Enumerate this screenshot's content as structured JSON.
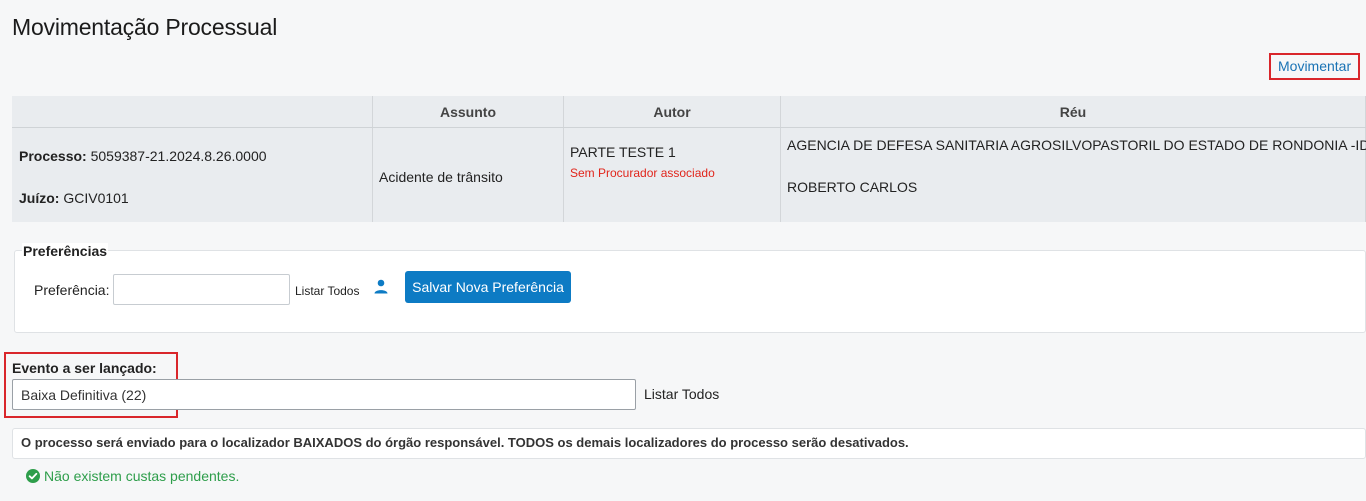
{
  "page": {
    "title": "Movimentação Processual"
  },
  "actions": {
    "movimentar_label": "Movimentar"
  },
  "table": {
    "headers": [
      "",
      "Assunto",
      "Autor",
      "Réu"
    ],
    "processo_label": "Processo:",
    "processo_value": "5059387-21.2024.8.26.0000",
    "juizo_label": "Juízo:",
    "juizo_value": "GCIV0101",
    "assunto": "Acidente de trânsito",
    "autor": "PARTE TESTE 1",
    "autor_note": "Sem Procurador associado",
    "reu": [
      "AGENCIA DE DEFESA SANITARIA AGROSILVOPASTORIL DO ESTADO DE RONDONIA -IDARON",
      "ROBERTO CARLOS"
    ]
  },
  "preferencias": {
    "legend": "Preferências",
    "label": "Preferência:",
    "input_value": "",
    "listar_todos": "Listar Todos",
    "save_button": "Salvar Nova Preferência"
  },
  "evento": {
    "label": "Evento a ser lançado:",
    "value": "Baixa Definitiva (22)",
    "listar_todos": "Listar Todos"
  },
  "message": "O processo será enviado para o localizador BAIXADOS do órgão responsável. TODOS os demais localizadores do processo serão desativados.",
  "custas": "Não existem custas pendentes.",
  "colors": {
    "accent": "#0d7bc4",
    "highlight": "#d9262b",
    "success": "#2e9e4b",
    "warning": "#e1251b"
  },
  "icons": {
    "person": "person-icon",
    "check": "check-circle-icon"
  }
}
